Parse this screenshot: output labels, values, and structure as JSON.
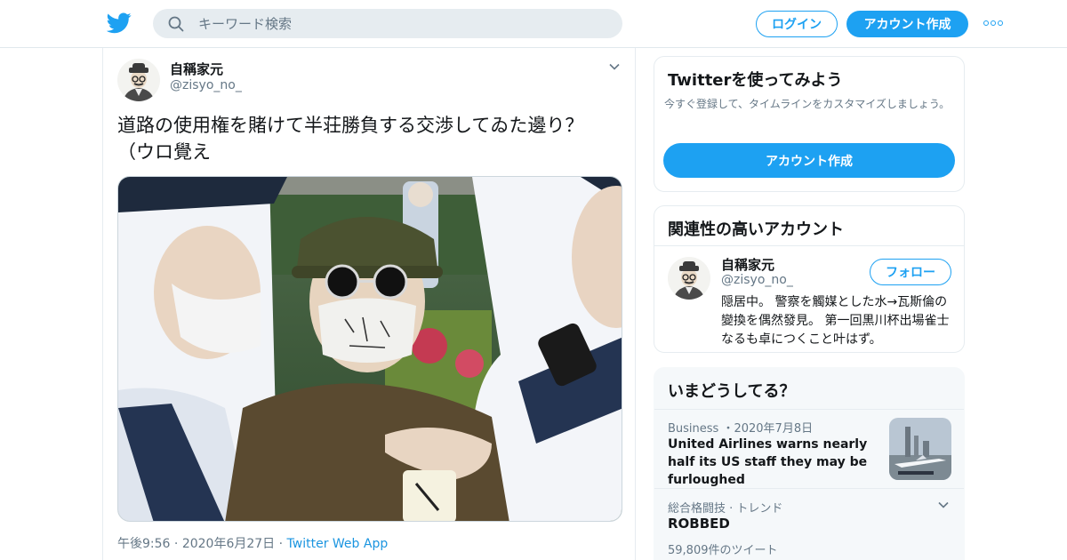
{
  "header": {
    "search_placeholder": "キーワード検索",
    "login_label": "ログイン",
    "signup_label": "アカウント作成",
    "icons": [
      "twitter-bird-icon",
      "search-icon",
      "more-icon"
    ],
    "accent": "#1da1f2"
  },
  "tweet": {
    "author_name": "自稱家元",
    "author_handle": "@zisyo_no_",
    "text": "道路の使用権を賭けて半荘勝負する交渉してゐた邊り？（ウロ覺え",
    "time": "午後9:56",
    "date": "2020年6月27日",
    "source": "Twitter Web App"
  },
  "sidebar": {
    "signup_card": {
      "title": "Twitterを使ってみよう",
      "subtitle": "今すぐ登録して、タイムラインをカスタマイズしましょう。",
      "button": "アカウント作成"
    },
    "related": {
      "title": "関連性の高いアカウント",
      "name": "自稱家元",
      "handle": "@zisyo_no_",
      "follow_label": "フォロー",
      "bio": "隠居中。 警察を觸媒とした水→瓦斯倫の變換を偶然發見。 第一回黒川杯出場雀士なるも卓につくこと叶はず。"
    },
    "trends": {
      "title": "いまどうしてる？",
      "items": [
        {
          "category": "Business ・2020年7月8日",
          "title": "United Airlines warns nearly half its US staff they may be furloughed"
        },
        {
          "category": "総合格闘技 · トレンド",
          "title": "ROBBED",
          "count": "59,809件のツイート"
        }
      ]
    }
  }
}
